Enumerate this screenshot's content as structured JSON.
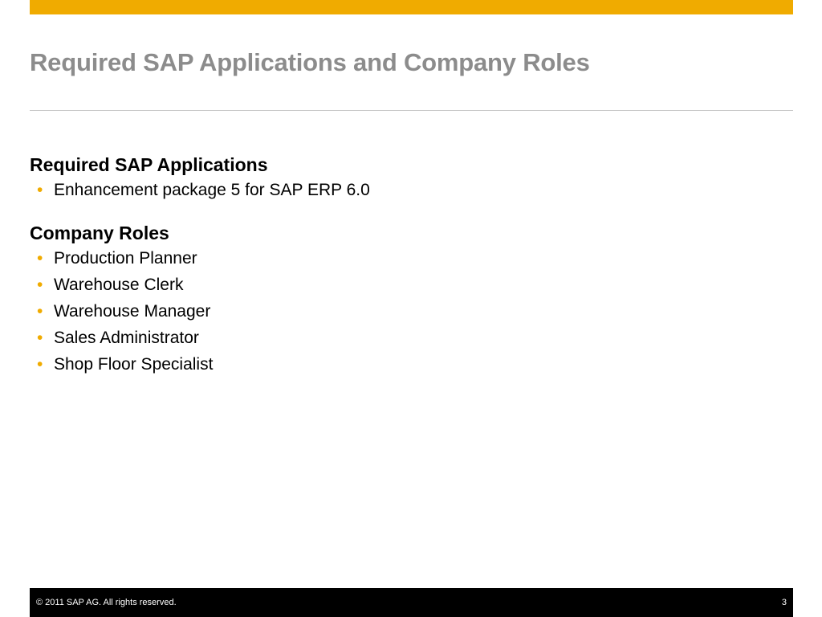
{
  "colors": {
    "accent_bar": "#f0ab00",
    "bullet": "#f0ab00",
    "title": "#8c8c8c",
    "footer_bg": "#000000"
  },
  "slide": {
    "title": "Required SAP Applications and Company Roles"
  },
  "sections": {
    "apps": {
      "heading": "Required SAP Applications",
      "items": [
        "Enhancement package 5 for SAP ERP 6.0"
      ]
    },
    "roles": {
      "heading": "Company Roles",
      "items": [
        "Production Planner",
        "Warehouse Clerk",
        "Warehouse Manager",
        "Sales Administrator",
        "Shop Floor Specialist"
      ]
    }
  },
  "bullet_glyph": "•",
  "footer": {
    "copyright": "©  2011 SAP AG. All rights reserved.",
    "page_number": "3"
  }
}
